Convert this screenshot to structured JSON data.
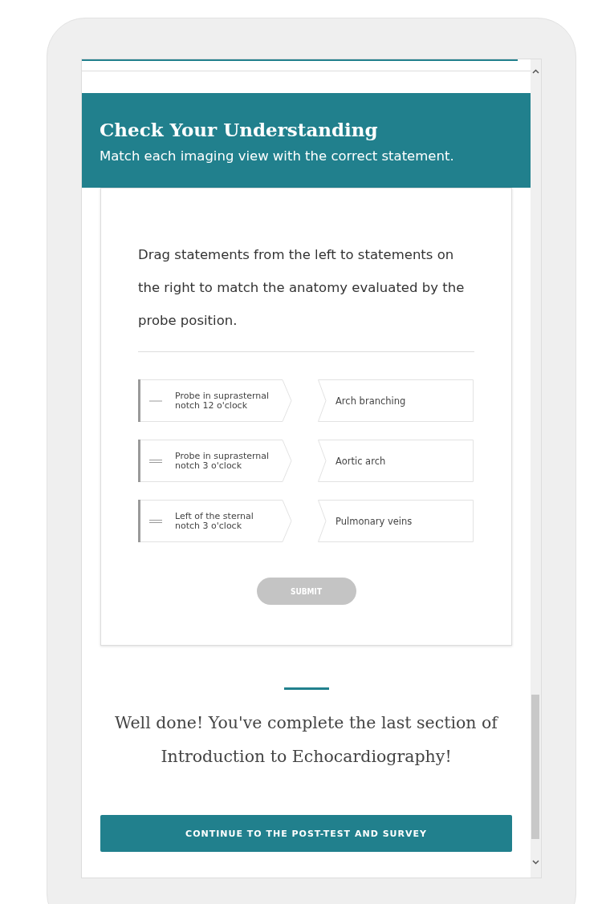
{
  "header": {
    "title": "Check Your Understanding",
    "subtitle": "Match each imaging view with the correct statement."
  },
  "question": {
    "prompt": "Drag statements from the left to statements on the right to match the anatomy evaluated by the probe position.",
    "pairs": [
      {
        "source": {
          "text": "Probe in suprasternal notch 12 o'clock",
          "kind": "single"
        },
        "target": "Arch branching"
      },
      {
        "source": {
          "text": "Probe in suprasternal notch 3 o'clock",
          "kind": "double"
        },
        "target": "Aortic arch"
      },
      {
        "source": {
          "text": "Left of the sternal notch 3 o'clock",
          "kind": "double"
        },
        "target": "Pulmonary veins"
      }
    ],
    "submit": {
      "label": "SUBMIT",
      "disabled": true
    }
  },
  "completion": {
    "message": "Well done! You've complete the last section of Introduction to Echocardiography!"
  },
  "continue_button": {
    "label": "CONTINUE TO THE POST-TEST AND SURVEY"
  }
}
